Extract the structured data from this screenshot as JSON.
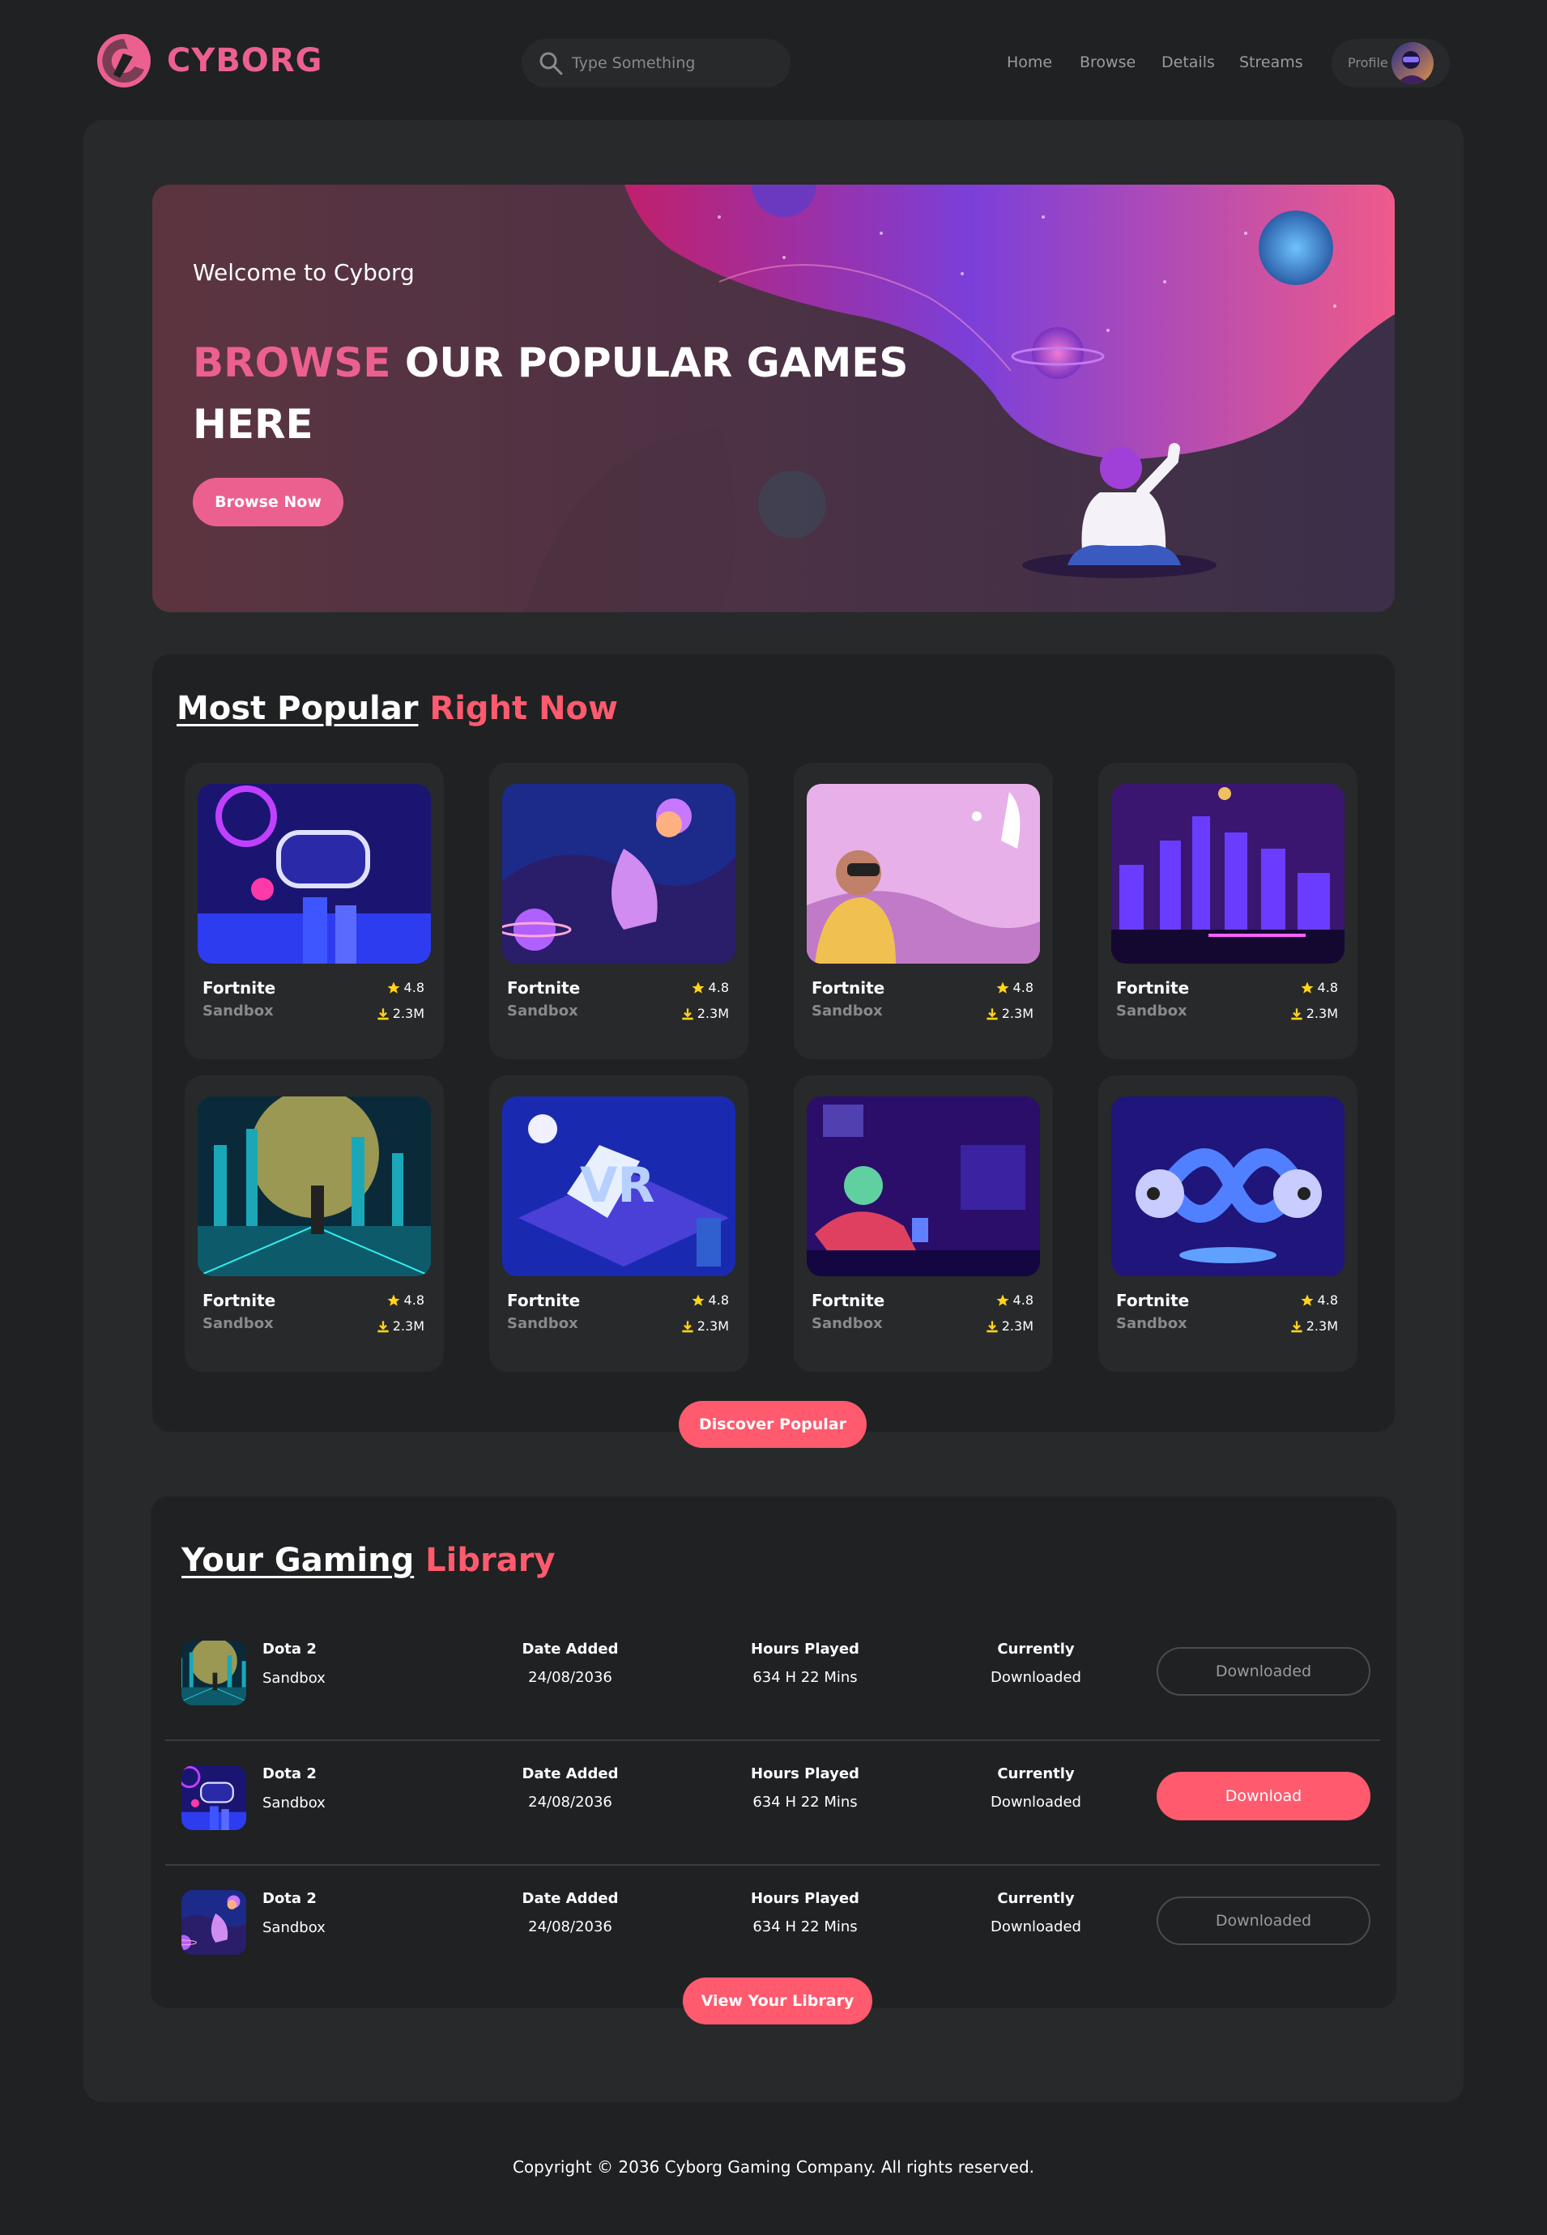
{
  "header": {
    "brand": "CYBORG",
    "search_placeholder": "Type Something",
    "nav": [
      "Home",
      "Browse",
      "Details",
      "Streams"
    ],
    "profile_label": "Profile"
  },
  "banner": {
    "welcome": "Welcome to Cyborg",
    "headline_accent": "BROWSE",
    "headline_rest": " OUR POPULAR GAMES HERE",
    "button": "Browse Now"
  },
  "popular": {
    "title_main": "Most Popular",
    "title_accent": " Right Now",
    "cards": [
      {
        "title": "Fortnite",
        "category": "Sandbox",
        "rating": "4.8",
        "downloads": "2.3M"
      },
      {
        "title": "Fortnite",
        "category": "Sandbox",
        "rating": "4.8",
        "downloads": "2.3M"
      },
      {
        "title": "Fortnite",
        "category": "Sandbox",
        "rating": "4.8",
        "downloads": "2.3M"
      },
      {
        "title": "Fortnite",
        "category": "Sandbox",
        "rating": "4.8",
        "downloads": "2.3M"
      },
      {
        "title": "Fortnite",
        "category": "Sandbox",
        "rating": "4.8",
        "downloads": "2.3M"
      },
      {
        "title": "Fortnite",
        "category": "Sandbox",
        "rating": "4.8",
        "downloads": "2.3M"
      },
      {
        "title": "Fortnite",
        "category": "Sandbox",
        "rating": "4.8",
        "downloads": "2.3M"
      },
      {
        "title": "Fortnite",
        "category": "Sandbox",
        "rating": "4.8",
        "downloads": "2.3M"
      }
    ],
    "button": "Discover Popular"
  },
  "library": {
    "title_main": "Your Gaming",
    "title_accent": " Library",
    "rows": [
      {
        "name": "Dota 2",
        "category": "Sandbox",
        "date_label": "Date Added",
        "date": "24/08/2036",
        "hours_label": "Hours Played",
        "hours": "634 H 22 Mins",
        "status_label": "Currently",
        "status": "Downloaded",
        "button": "Downloaded"
      },
      {
        "name": "Dota 2",
        "category": "Sandbox",
        "date_label": "Date Added",
        "date": "24/08/2036",
        "hours_label": "Hours Played",
        "hours": "634 H 22 Mins",
        "status_label": "Currently",
        "status": "Downloaded",
        "button": "Download"
      },
      {
        "name": "Dota 2",
        "category": "Sandbox",
        "date_label": "Date Added",
        "date": "24/08/2036",
        "hours_label": "Hours Played",
        "hours": "634 H 22 Mins",
        "status_label": "Currently",
        "status": "Downloaded",
        "button": "Downloaded"
      }
    ],
    "button": "View Your Library"
  },
  "footer": {
    "text": "Copyright © 2036 Cyborg Gaming Company. All rights reserved."
  },
  "colors": {
    "accent": "#ec6090",
    "button": "#ff5a6e",
    "background": "#1f2122",
    "panel": "#27292a"
  }
}
